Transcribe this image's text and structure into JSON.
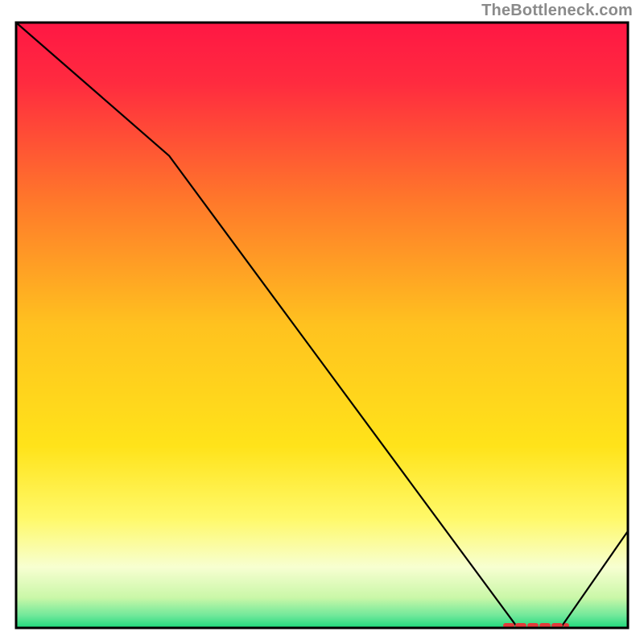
{
  "watermark": "TheBottleneck.com",
  "chart_data": {
    "type": "line",
    "title": "",
    "xlabel": "",
    "ylabel": "",
    "xlim": [
      0,
      100
    ],
    "ylim": [
      0,
      100
    ],
    "x": [
      0,
      25,
      82,
      89,
      100
    ],
    "values": [
      100,
      78,
      0,
      0,
      16
    ],
    "minimum_region": {
      "x_from": 80,
      "x_to": 90,
      "y": 0
    },
    "annotations": [],
    "background": {
      "description": "vertical red→yellow→green gradient inside plot area",
      "stops": [
        {
          "pos": 0.0,
          "color": "#ff1744"
        },
        {
          "pos": 0.1,
          "color": "#ff2b3f"
        },
        {
          "pos": 0.3,
          "color": "#ff7a2a"
        },
        {
          "pos": 0.5,
          "color": "#ffc21f"
        },
        {
          "pos": 0.7,
          "color": "#ffe31a"
        },
        {
          "pos": 0.82,
          "color": "#fff96a"
        },
        {
          "pos": 0.9,
          "color": "#f7ffd1"
        },
        {
          "pos": 0.95,
          "color": "#caf7a8"
        },
        {
          "pos": 0.98,
          "color": "#6fe89a"
        },
        {
          "pos": 1.0,
          "color": "#1ed97c"
        }
      ]
    }
  }
}
